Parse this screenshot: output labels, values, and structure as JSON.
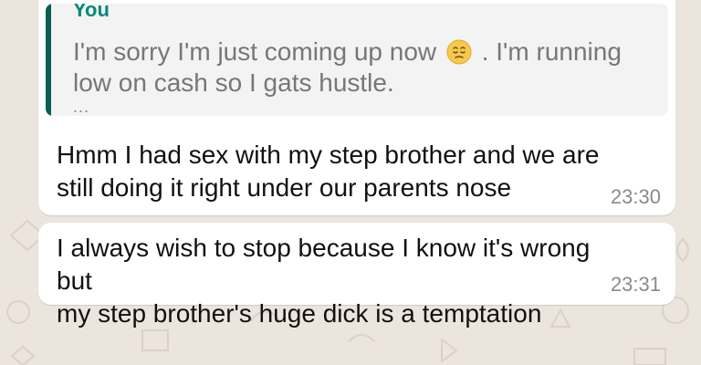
{
  "chat": {
    "reply_quote": {
      "sender": "You",
      "text_before_emoji": "I'm sorry I'm just coming up now",
      "emoji_name": "pensive-face-icon",
      "text_after_emoji": ". I'm running low on cash so I gats hustle.",
      "ellipsis": "..."
    },
    "messages": [
      {
        "line_1": "Hmm I had sex with my step brother and we are",
        "line_2": "still doing it right under our parents nose",
        "time": "23:30"
      },
      {
        "line_1": "I always wish to stop because I know it's wrong but",
        "line_2": "my step brother's huge dick is a temptation",
        "time": "23:31"
      }
    ]
  },
  "colors": {
    "background": "#ece5dd",
    "bubble": "#ffffff",
    "quote_bar": "#075e54",
    "quote_sender": "#00897b",
    "timestamp": "#8a8a8a"
  }
}
